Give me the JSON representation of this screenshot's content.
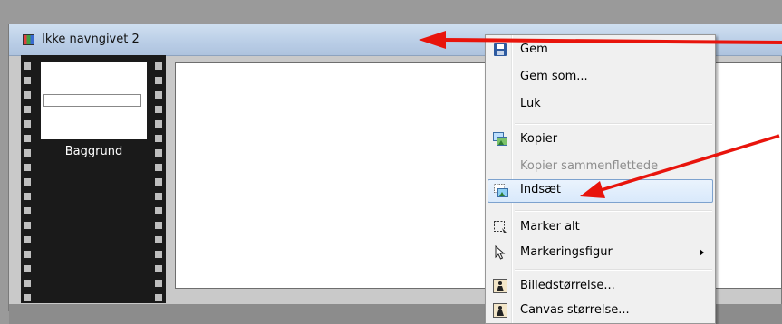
{
  "window": {
    "title": "Ikke navngivet 2"
  },
  "filmstrip": {
    "frame_label": "Baggrund"
  },
  "context_menu": {
    "items": [
      {
        "label": "Gem",
        "icon": "save-icon",
        "enabled": true
      },
      {
        "label": "Gem som...",
        "icon": "",
        "enabled": true
      },
      {
        "label": "Luk",
        "icon": "",
        "enabled": true
      },
      {
        "label": "Kopier",
        "icon": "copy-image-icon",
        "enabled": true
      },
      {
        "label": "Kopier sammenflettede",
        "icon": "",
        "enabled": false
      },
      {
        "label": "Indsæt",
        "icon": "paste-image-icon",
        "enabled": true,
        "highlighted": true
      },
      {
        "label": "Marker alt",
        "icon": "select-all-icon",
        "enabled": true
      },
      {
        "label": "Markeringsfigur",
        "icon": "pointer-icon",
        "enabled": true,
        "submenu": true
      },
      {
        "label": "Billedstørrelse...",
        "icon": "image-size-icon",
        "enabled": true
      },
      {
        "label": "Canvas størrelse...",
        "icon": "canvas-size-icon",
        "enabled": true
      }
    ]
  },
  "colors": {
    "annotation_arrow": "#e8140c",
    "title_bar": "#b9cde6",
    "menu_highlight": "#d9e9fb"
  }
}
